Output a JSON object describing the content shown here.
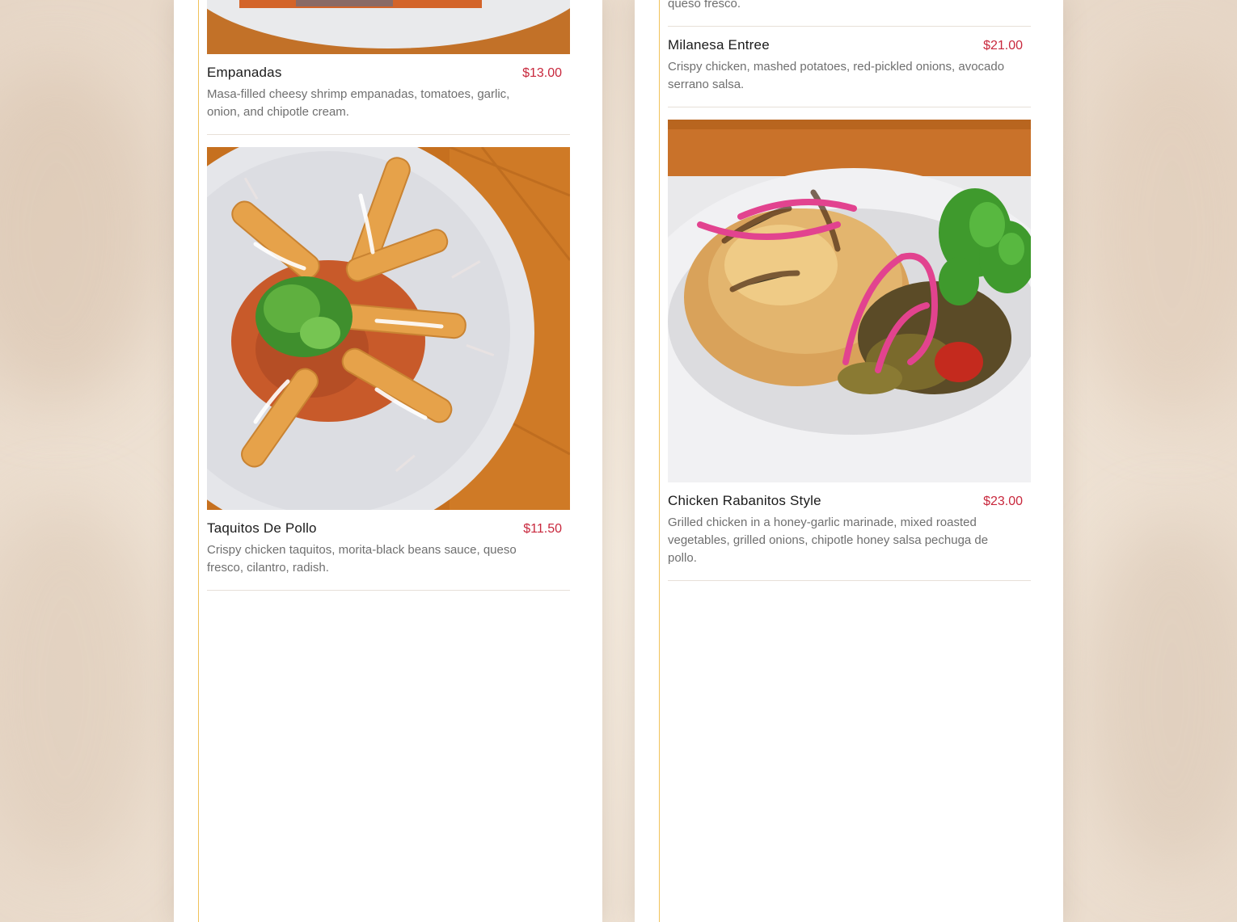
{
  "theme": {
    "accent": "#c8283d",
    "rail": "#f0c25a",
    "text": "#1b1b1b",
    "muted": "#6f6f6f"
  },
  "left_column": {
    "items": [
      {
        "name": "Empanadas",
        "price": "$13.00",
        "description": "Masa-filled cheesy shrimp empanadas, tomatoes, garlic, onion, and chipotle cream."
      },
      {
        "name": "Taquitos De Pollo",
        "price": "$11.50",
        "description": "Crispy chicken taquitos, morita-black beans sauce, queso fresco, cilantro, radish."
      }
    ]
  },
  "right_column": {
    "cut_off_text": "queso fresco.",
    "items": [
      {
        "name": "Milanesa Entree",
        "price": "$21.00",
        "description": "Crispy chicken, mashed potatoes, red-pickled onions, avocado serrano salsa."
      },
      {
        "name": "Chicken Rabanitos Style",
        "price": "$23.00",
        "description": "Grilled chicken in a honey-garlic marinade, mixed roasted vegetables, grilled onions, chipotle honey salsa pechuga de pollo."
      }
    ]
  }
}
